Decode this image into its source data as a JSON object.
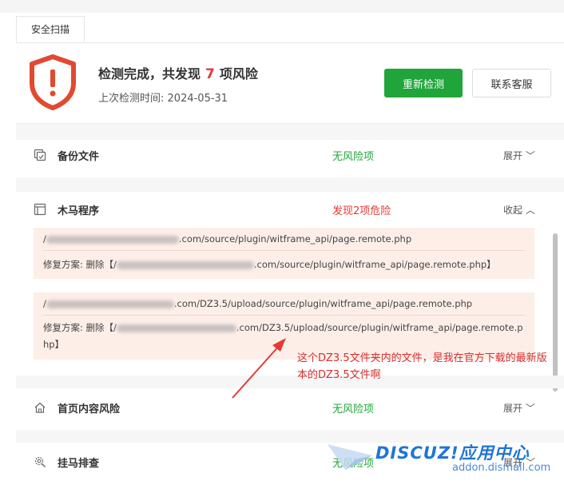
{
  "tabs": [
    {
      "label": "安全扫描"
    }
  ],
  "header": {
    "title_prefix": "检测完成，共发现",
    "risk_count": "7",
    "title_suffix": "项风险",
    "last_check_label": "上次检测时间:",
    "last_check_date": "2024-05-31",
    "rescan_button": "重新检测",
    "support_button": "联系客服"
  },
  "sections": [
    {
      "name": "备份文件",
      "status": "无风险项",
      "toggle": "展开",
      "icon": "backup-icon"
    },
    {
      "name": "木马程序",
      "status": "发现2项危险",
      "toggle": "收起",
      "icon": "trojan-icon"
    },
    {
      "name": "首页内容风险",
      "status": "无风险项",
      "toggle": "展开",
      "icon": "home-icon"
    },
    {
      "name": "挂马排查",
      "status": "无风险项",
      "toggle": "展开",
      "icon": "gear-search-icon"
    }
  ],
  "findings": [
    {
      "path_prefix": "/",
      "path_suffix": ".com/source/plugin/witframe_api/page.remote.php",
      "fix_label": "修复方案:",
      "fix_action": "删除【/",
      "fix_path_suffix": ".com/source/plugin/witframe_api/page.remote.php】"
    },
    {
      "path_prefix": "/",
      "path_suffix": ".com/DZ3.5/upload/source/plugin/witframe_api/page.remote.php",
      "fix_label": "修复方案:",
      "fix_action": "删除【/",
      "fix_path_suffix": ".com/DZ3.5/upload/source/plugin/witframe_api/page.remote.php】"
    }
  ],
  "annotation": "这个DZ3.5文件夹内的文件，是我在官方下载的最新版本的DZ3.5文件啊",
  "watermark": {
    "main": "DISCUZ!应用中心",
    "sub": "addon.dismall.com"
  },
  "colors": {
    "safe": "#20a53a",
    "danger": "#e53935",
    "finding_bg": "#fdeee8",
    "brand_blue": "#1f75d6"
  }
}
